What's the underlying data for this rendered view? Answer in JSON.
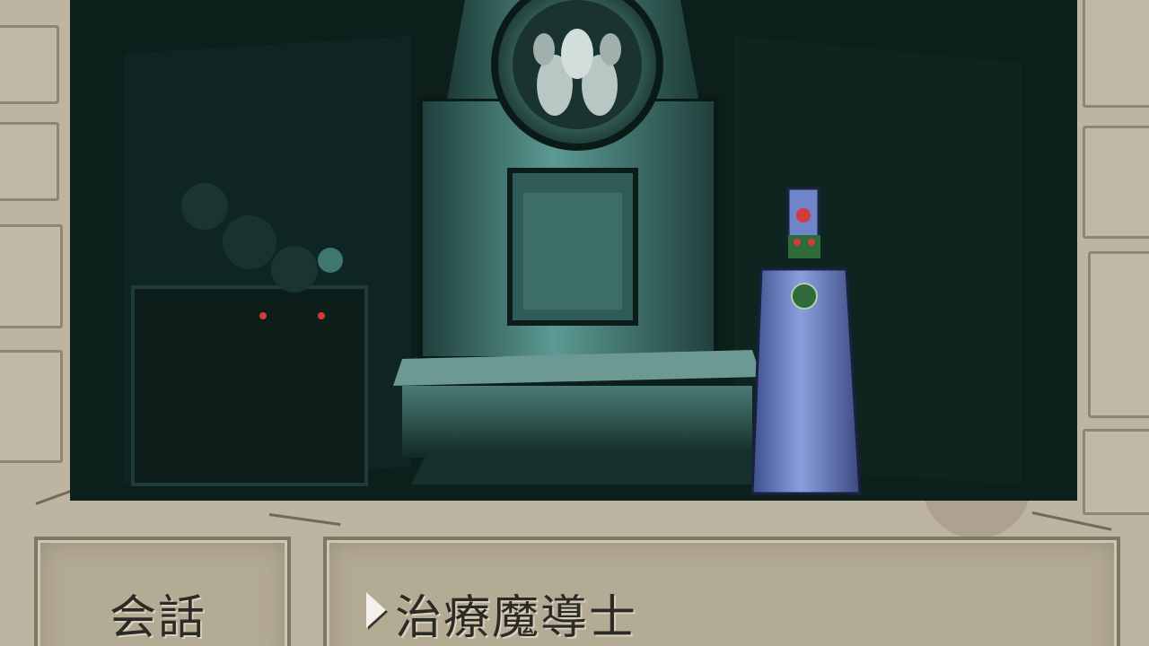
{
  "game": {
    "scene": {
      "location": "",
      "npc": {
        "name_label": "治療魔導士"
      }
    },
    "menu": {
      "command_label": "会話"
    },
    "message": {
      "target_label": "治療魔導士",
      "cursor_icon": "triangle-cursor-icon"
    }
  },
  "colors": {
    "stone": "#bdb4a1",
    "scene_bg": "#0e211c",
    "machine_teal": "#4f8f8a",
    "robe_blue": "#6f86c8",
    "text": "#2c2a25",
    "cursor": "#f4f1ea"
  }
}
